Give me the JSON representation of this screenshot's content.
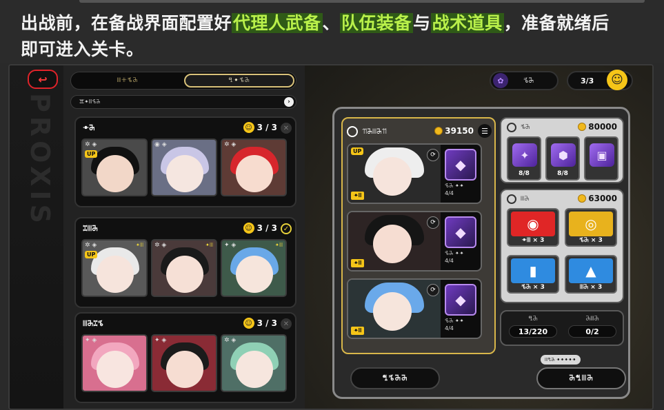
{
  "caption": {
    "line1_prefix": "出战前，在备战界面配置好",
    "hl1": "代理人武备",
    "sep": "、",
    "hl2": "队伍装备",
    "mid": "与",
    "hl3": "战术道具",
    "line1_suffix": "，准备就绪后",
    "line2": "即可进入关卡。"
  },
  "left_rail": {
    "vertical_text": "PROXIS",
    "back_icon": "back-arrow-icon"
  },
  "tabs": [
    {
      "label": "ꔖꔰꕦꔕ"
    },
    {
      "label": "ꔡꔹꕦꔕ"
    }
  ],
  "filter": {
    "label": "ꕭꔹꔖꕦꔕ"
  },
  "squads": [
    {
      "name": "ꔹꔕ",
      "count": "3 / 3",
      "state": "empty"
    },
    {
      "name": "ꔙꔖꔕ",
      "count": "3 / 3",
      "state": "ready"
    },
    {
      "name": "ꔖꔕꔙꕦ",
      "count": "3 / 3",
      "state": "empty"
    }
  ],
  "portrait_badge": "UP",
  "top_right": {
    "mode_label": "ꕦꔕ",
    "team_count": "3/3"
  },
  "agents_panel": {
    "label": "ꔔꔕꔖꔕꔔ",
    "coins": "39150"
  },
  "agents": [
    {
      "tag": "ꔹꔖ",
      "weapon_level": "ꕦꔕ ꔹꔹ",
      "weapon_count": "4/4"
    },
    {
      "tag": "ꔹꔖ",
      "weapon_level": "ꕦꔕ ꔹꔹ",
      "weapon_count": "4/4"
    },
    {
      "tag": "ꔹꔖ",
      "weapon_level": "ꕦꔕ ꔹꔹ",
      "weapon_count": "4/4"
    }
  ],
  "equipment_block": {
    "label": "ꕦꔕ",
    "coins": "80000",
    "items": [
      {
        "count": "8/8"
      },
      {
        "count": "8/8"
      },
      {
        "count": ""
      }
    ]
  },
  "tools_block": {
    "label": "ꔖꔕ",
    "coins": "63000",
    "items": [
      {
        "count": "ꔹꔖ × 3"
      },
      {
        "count": "ꕦꔕ × 3"
      },
      {
        "count": "ꕦꔕ × 3"
      },
      {
        "count": "ꔖꔕ × 3"
      }
    ]
  },
  "stats": [
    {
      "label": "ꔡꔕ",
      "value": "13/220"
    },
    {
      "label": "ꔕꔖꔕ",
      "value": "0/2"
    }
  ],
  "bottom": {
    "left_button": "ꔡꕦꔕꔕ",
    "right_button": "ꔕꔡꔖꔕ",
    "note": "ꔖꔡꔕ ꔹꔹꔹꔹꔹ"
  },
  "colors": {
    "highlight_bg": "#2f5a17",
    "highlight_fg": "#b9f04a",
    "accent_gold": "#f5c518",
    "back_red": "#e0232a"
  }
}
